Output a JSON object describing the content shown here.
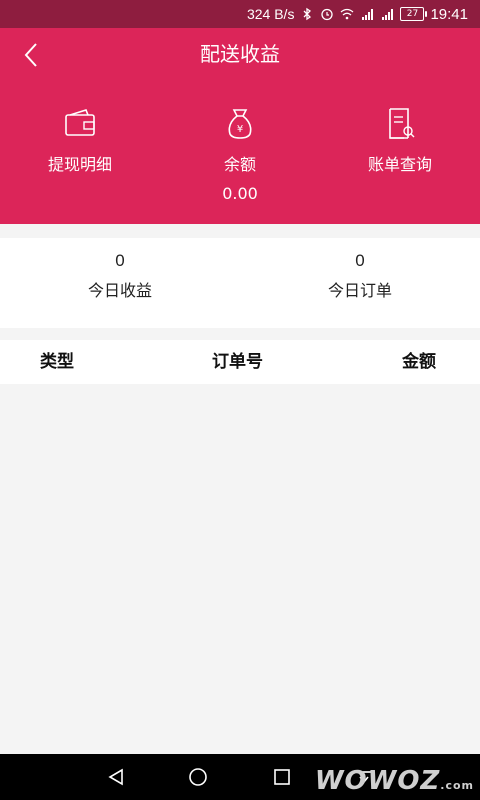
{
  "status_bar": {
    "speed": "324 B/s",
    "battery": "27",
    "time": "19:41"
  },
  "header": {
    "title": "配送收益"
  },
  "actions": [
    {
      "label": "提现明细",
      "icon": "wallet-icon"
    },
    {
      "label": "余额",
      "value": "0.00",
      "icon": "money-bag-icon"
    },
    {
      "label": "账单查询",
      "icon": "bill-search-icon"
    }
  ],
  "stats": [
    {
      "value": "0",
      "label": "今日收益"
    },
    {
      "value": "0",
      "label": "今日订单"
    }
  ],
  "table": {
    "headers": [
      "类型",
      "订单号",
      "金额"
    ]
  },
  "watermark": {
    "text": "WOWOZ",
    "suffix": ".com"
  },
  "colors": {
    "header_bg": "#dc2559",
    "status_bg": "#8e1d3f",
    "background": "#f4f4f4"
  }
}
